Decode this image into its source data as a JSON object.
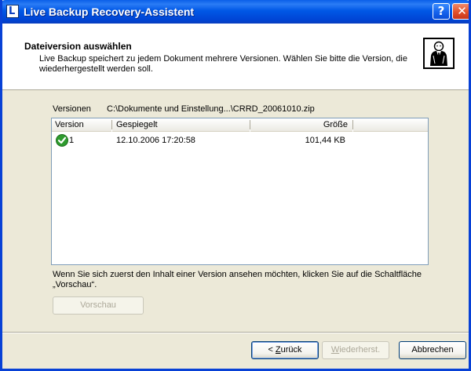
{
  "window": {
    "title": "Live Backup Recovery-Assistent",
    "app_icon_glyph": "L",
    "help_glyph": "?",
    "close_glyph": "✕"
  },
  "header": {
    "title": "Dateiversion auswählen",
    "description": "Live Backup speichert zu jedem Dokument mehrere Versionen. Wählen Sie bitte die Version, die wiederhergestellt werden soll.",
    "icon": "wizard-person-icon"
  },
  "versions": {
    "label": "Versionen",
    "path": "C:\\Dokumente und Einstellung...\\CRRD_20061010.zip",
    "columns": [
      "Version",
      "Gespiegelt",
      "Größe"
    ],
    "rows": [
      {
        "version": "1",
        "mirrored": "12.10.2006 17:20:58",
        "size": "101,44 KB",
        "status_icon": "check-icon"
      }
    ]
  },
  "hint": "Wenn Sie sich zuerst den Inhalt einer Version ansehen möchten, klicken Sie auf die Schaltfläche „Vorschau“.",
  "buttons": {
    "preview": "Vorschau",
    "back_prefix": "< ",
    "back_accel": "Z",
    "back_rest": "urück",
    "restore_accel": "W",
    "restore_rest": "iederherst.",
    "cancel": "Abbrechen"
  },
  "colors": {
    "titlebar": "#0054E3",
    "window_bg": "#ECE9D8",
    "check_green": "#2E9B2E"
  }
}
